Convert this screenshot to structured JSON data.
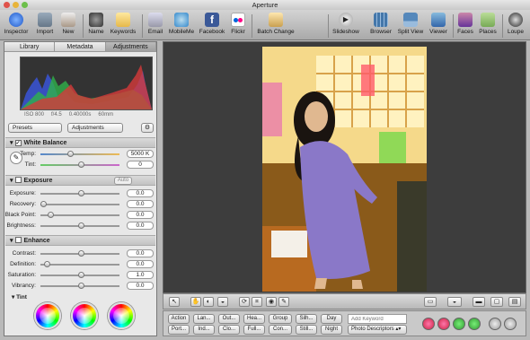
{
  "window": {
    "title": "Aperture"
  },
  "toolbar": {
    "items": [
      "Inspector",
      "Import",
      "New",
      "Name",
      "Keywords",
      "Email",
      "MobileMe",
      "Facebook",
      "Flickr",
      "Batch Change",
      "Slideshow",
      "Browser",
      "Split View",
      "Viewer",
      "Faces",
      "Places",
      "Loupe"
    ]
  },
  "inspector": {
    "tabs": [
      "Library",
      "Metadata",
      "Adjustments"
    ],
    "meta": {
      "iso": "ISO 800",
      "aperture": "f/4.5",
      "shutter": "0.40000s",
      "focal": "60mm"
    },
    "presets_label": "Presets",
    "adjustments_label": "Adjustments",
    "white_balance": {
      "title": "White Balance",
      "temp_label": "Temp:",
      "temp_value": "5000 K",
      "tint_label": "Tint:",
      "tint_value": "0"
    },
    "exposure": {
      "title": "Exposure",
      "auto": "Auto",
      "rows": [
        {
          "label": "Exposure:",
          "value": "0.0"
        },
        {
          "label": "Recovery:",
          "value": "0.0"
        },
        {
          "label": "Black Point:",
          "value": "0.0"
        },
        {
          "label": "Brightness:",
          "value": "0.0"
        }
      ]
    },
    "enhance": {
      "title": "Enhance",
      "rows": [
        {
          "label": "Contrast:",
          "value": "0.0"
        },
        {
          "label": "Definition:",
          "value": "0.0"
        },
        {
          "label": "Saturation:",
          "value": "1.0"
        },
        {
          "label": "Vibrancy:",
          "value": "0.0"
        }
      ]
    },
    "tint_title": "Tint"
  },
  "keywords": {
    "row1": [
      "Action",
      "Lan...",
      "Out...",
      "Hea...",
      "Group",
      "Silh...",
      "Day"
    ],
    "row2": [
      "Port...",
      "Ind...",
      "Clo...",
      "Full...",
      "Con...",
      "Still...",
      "Night"
    ],
    "add_placeholder": "Add Keyword",
    "descriptor": "Photo Descriptors"
  }
}
